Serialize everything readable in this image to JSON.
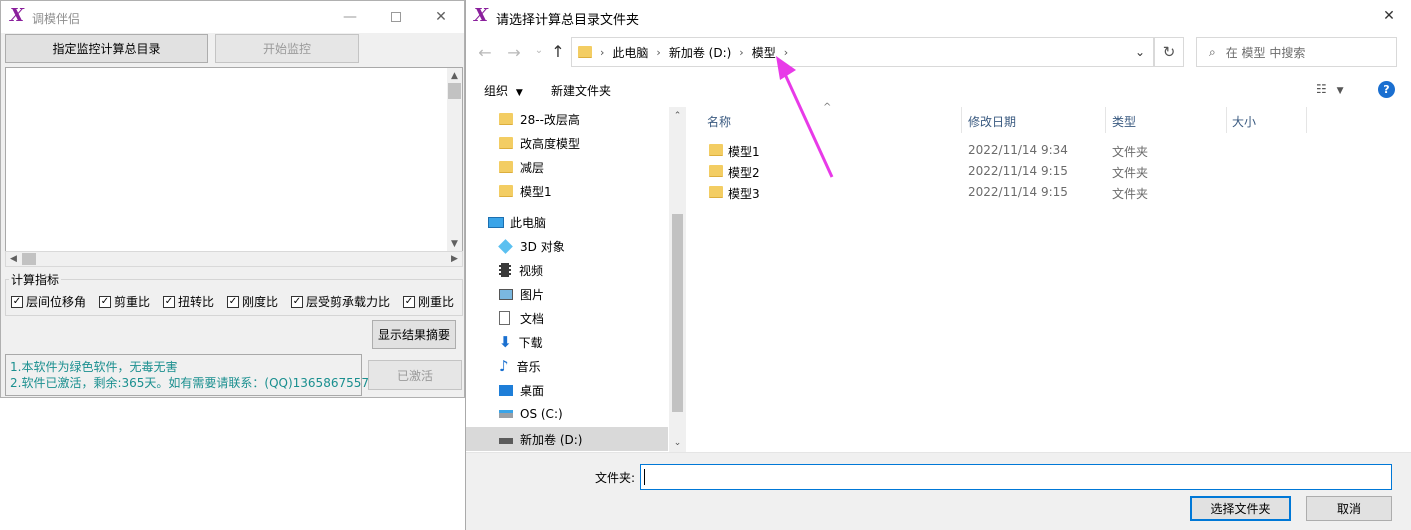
{
  "app": {
    "title": "调模伴侣",
    "logo_text": "X",
    "buttons": {
      "select_dir": "指定监控计算总目录",
      "start_monitor": "开始监控",
      "show_summary": "显示结果摘要",
      "activated": "已激活"
    },
    "group_title": "计算指标",
    "checkboxes": [
      {
        "label": "层间位移角",
        "checked": true
      },
      {
        "label": "剪重比",
        "checked": true
      },
      {
        "label": "扭转比",
        "checked": true
      },
      {
        "label": "刚度比",
        "checked": true
      },
      {
        "label": "层受剪承载力比",
        "checked": true
      },
      {
        "label": "刚重比",
        "checked": true
      }
    ],
    "info_lines": [
      "1.本软件为绿色软件，无毒无害",
      "2.软件已激活，剩余:365天。如有需要请联系：(QQ)1365867557"
    ],
    "info_color": "#1a8f8f"
  },
  "dialog": {
    "title": "请选择计算总目录文件夹",
    "breadcrumb": [
      "此电脑",
      "新加卷 (D:)",
      "模型"
    ],
    "search_placeholder": "在 模型 中搜索",
    "toolbar": {
      "organize": "组织",
      "new_folder": "新建文件夹"
    },
    "tree": {
      "folders": [
        "28--改层高",
        "改高度模型",
        "减层",
        "模型1"
      ],
      "this_pc": "此电脑",
      "pc_items": [
        {
          "label": "3D 对象",
          "icon": "cube-icon"
        },
        {
          "label": "视频",
          "icon": "video-icon"
        },
        {
          "label": "图片",
          "icon": "picture-icon"
        },
        {
          "label": "文档",
          "icon": "document-icon"
        },
        {
          "label": "下载",
          "icon": "download-icon"
        },
        {
          "label": "音乐",
          "icon": "music-icon"
        },
        {
          "label": "桌面",
          "icon": "desktop-icon"
        },
        {
          "label": "OS (C:)",
          "icon": "drive-c-icon"
        },
        {
          "label": "新加卷 (D:)",
          "icon": "drive-d-icon",
          "selected": true
        }
      ]
    },
    "columns": {
      "name": "名称",
      "date": "修改日期",
      "type": "类型",
      "size": "大小"
    },
    "files": [
      {
        "name": "模型1",
        "date": "2022/11/14 9:34",
        "type": "文件夹"
      },
      {
        "name": "模型2",
        "date": "2022/11/14 9:15",
        "type": "文件夹"
      },
      {
        "name": "模型3",
        "date": "2022/11/14 9:15",
        "type": "文件夹"
      }
    ],
    "footer": {
      "folder_label": "文件夹:",
      "folder_value": "",
      "select_button": "选择文件夹",
      "cancel_button": "取消"
    },
    "accent_color": "#0078d7",
    "annotation_arrow_color": "#e83ae8"
  }
}
